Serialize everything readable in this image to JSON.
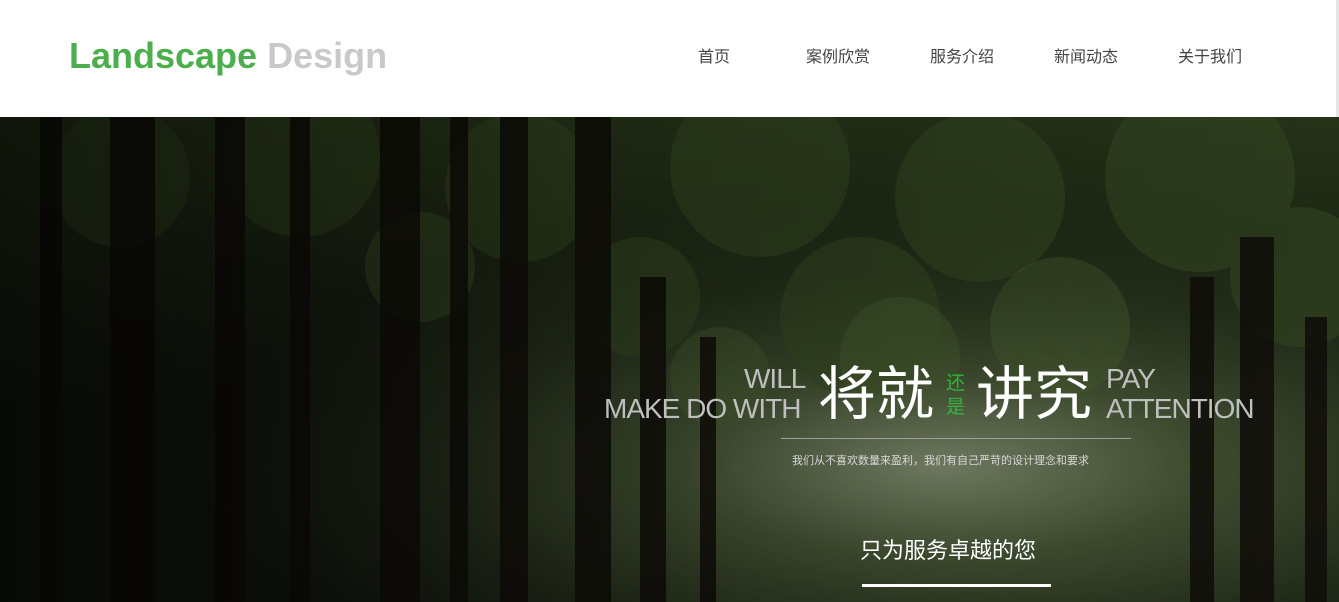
{
  "header": {
    "logo_primary": "Landscape",
    "logo_secondary": "Design",
    "nav": [
      {
        "label": "首页"
      },
      {
        "label": "案例欣赏"
      },
      {
        "label": "服务介绍"
      },
      {
        "label": "新闻动态"
      },
      {
        "label": "关于我们"
      }
    ]
  },
  "hero": {
    "left_en_line1": "WILL",
    "left_en_line2": "MAKE DO WITH",
    "cn_word1": "将就",
    "cn_connector_top": "还",
    "cn_connector_bottom": "是",
    "cn_word2": "讲究",
    "right_en_line1": "PAY",
    "right_en_line2": "ATTENTION",
    "subtitle": "我们从不喜欢数量来盈利，我们有自己严苛的设计理念和要求",
    "slogan": "只为服务卓越的您"
  },
  "colors": {
    "brand_green": "#4cae4c",
    "logo_gray": "#c9c9c9",
    "accent_green": "#2fb53a"
  }
}
